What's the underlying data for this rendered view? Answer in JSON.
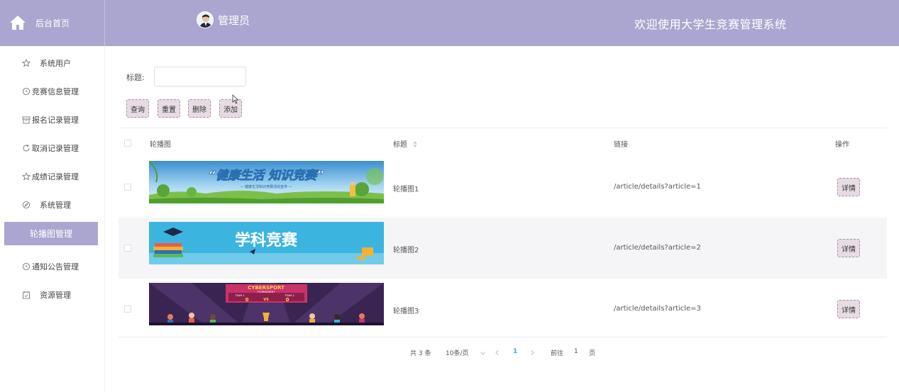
{
  "header": {
    "home_label": "后台首页",
    "admin_label": "管理员",
    "welcome": "欢迎使用大学生竞赛管理系统"
  },
  "sidebar": {
    "items": [
      {
        "label": "系统用户",
        "icon": "star-icon"
      },
      {
        "label": "竞赛信息管理",
        "icon": "clock-icon"
      },
      {
        "label": "报名记录管理",
        "icon": "archive-icon"
      },
      {
        "label": "取消记录管理",
        "icon": "refresh-icon"
      },
      {
        "label": "成绩记录管理",
        "icon": "star-icon"
      },
      {
        "label": "系统管理",
        "icon": "compass-icon"
      },
      {
        "label": "轮播图管理",
        "icon": "",
        "active": true
      },
      {
        "label": "通知公告管理",
        "icon": "clock-icon"
      },
      {
        "label": "资源管理",
        "icon": "calendar-icon"
      }
    ]
  },
  "search": {
    "label": "标题:",
    "value": "",
    "placeholder": ""
  },
  "toolbar": {
    "query": "查询",
    "reset": "重置",
    "delete": "删除",
    "add": "添加"
  },
  "table": {
    "headers": {
      "image": "轮播图",
      "title": "标题",
      "link": "链接",
      "action": "操作"
    },
    "rows": [
      {
        "title": "轮播图1",
        "link": "/article/details?article=1",
        "action": "详情",
        "banner_text": "“健康生活 知识竞赛”",
        "banner_sub": "— 健康生活知识竞赛活动宣传 —"
      },
      {
        "title": "轮播图2",
        "link": "/article/details?article=2",
        "action": "详情",
        "banner_text": "学科竞赛"
      },
      {
        "title": "轮播图3",
        "link": "/article/details?article=3",
        "action": "详情",
        "banner_text": "CYBERSPORT",
        "banner_sub": "TOURNAMENT",
        "team1": "TEAM 1",
        "team2": "TEAM 2",
        "score1": "0",
        "score2": "0",
        "vs": "VS"
      }
    ]
  },
  "pagination": {
    "total": "共 3 条",
    "page_size": "10条/页",
    "current": "1",
    "goto_label": "前往",
    "goto_value": "1",
    "page_unit": "页"
  },
  "colors": {
    "header_bg": "#aaa6cf",
    "button_bg": "#e7dce4",
    "active_page": "#409eff"
  }
}
